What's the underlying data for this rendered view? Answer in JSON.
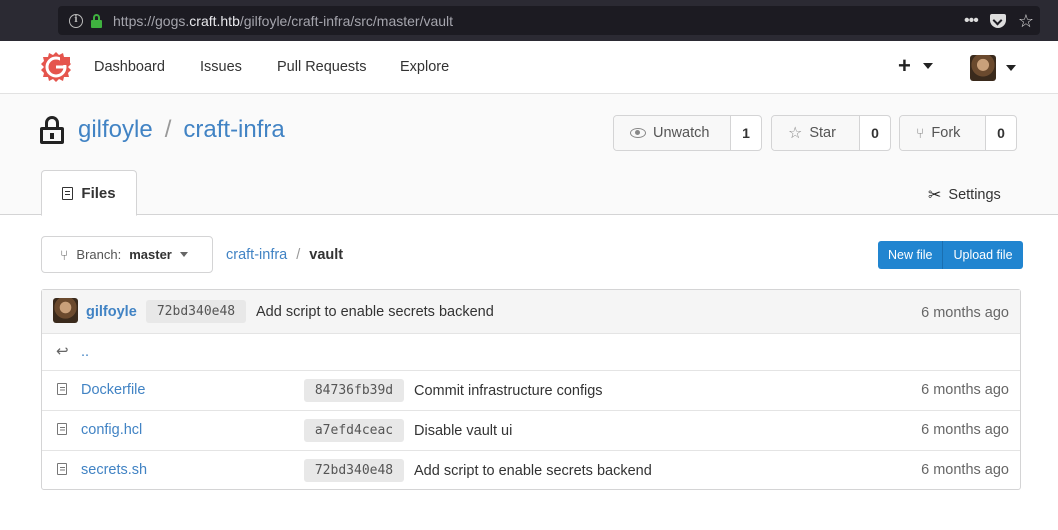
{
  "browser": {
    "url_prefix": "https://gogs.",
    "url_domain": "craft.htb",
    "url_path": "/gilfoyle/craft-infra/src/master/vault",
    "menu_dots": "•••",
    "star_glyph": "☆"
  },
  "header": {
    "nav": [
      "Dashboard",
      "Issues",
      "Pull Requests",
      "Explore"
    ],
    "plus_glyph": "+"
  },
  "repo": {
    "owner": "gilfoyle",
    "separator": "/",
    "name": "craft-infra",
    "watch": {
      "label": "Unwatch",
      "count": "1"
    },
    "star": {
      "label": "Star",
      "count": "0",
      "glyph": "☆"
    },
    "fork": {
      "label": "Fork",
      "count": "0",
      "glyph": "⑂"
    },
    "tabs": {
      "files": "Files",
      "settings": "Settings",
      "settings_glyph": "✂"
    }
  },
  "path_bar": {
    "branch_prefix": "Branch:",
    "branch": "master",
    "branch_glyph": "⑂",
    "crumb_root": "craft-infra",
    "crumb_sep": "/",
    "crumb_current": "vault",
    "new_file": "New file",
    "upload_file": "Upload file"
  },
  "latest_commit": {
    "author": "gilfoyle",
    "sha": "72bd340e48",
    "message": "Add script to enable secrets backend",
    "time": "6 months ago"
  },
  "parent": {
    "label": "..",
    "glyph": "↩"
  },
  "files": [
    {
      "name": "Dockerfile",
      "sha": "84736fb39d",
      "message": "Commit infrastructure configs",
      "time": "6 months ago"
    },
    {
      "name": "config.hcl",
      "sha": "a7efd4ceac",
      "message": "Disable vault ui",
      "time": "6 months ago"
    },
    {
      "name": "secrets.sh",
      "sha": "72bd340e48",
      "message": "Add script to enable secrets backend",
      "time": "6 months ago"
    }
  ],
  "colors": {
    "link": "#4183c4",
    "primary_button": "#2185d0",
    "logo": "#e5554d"
  }
}
